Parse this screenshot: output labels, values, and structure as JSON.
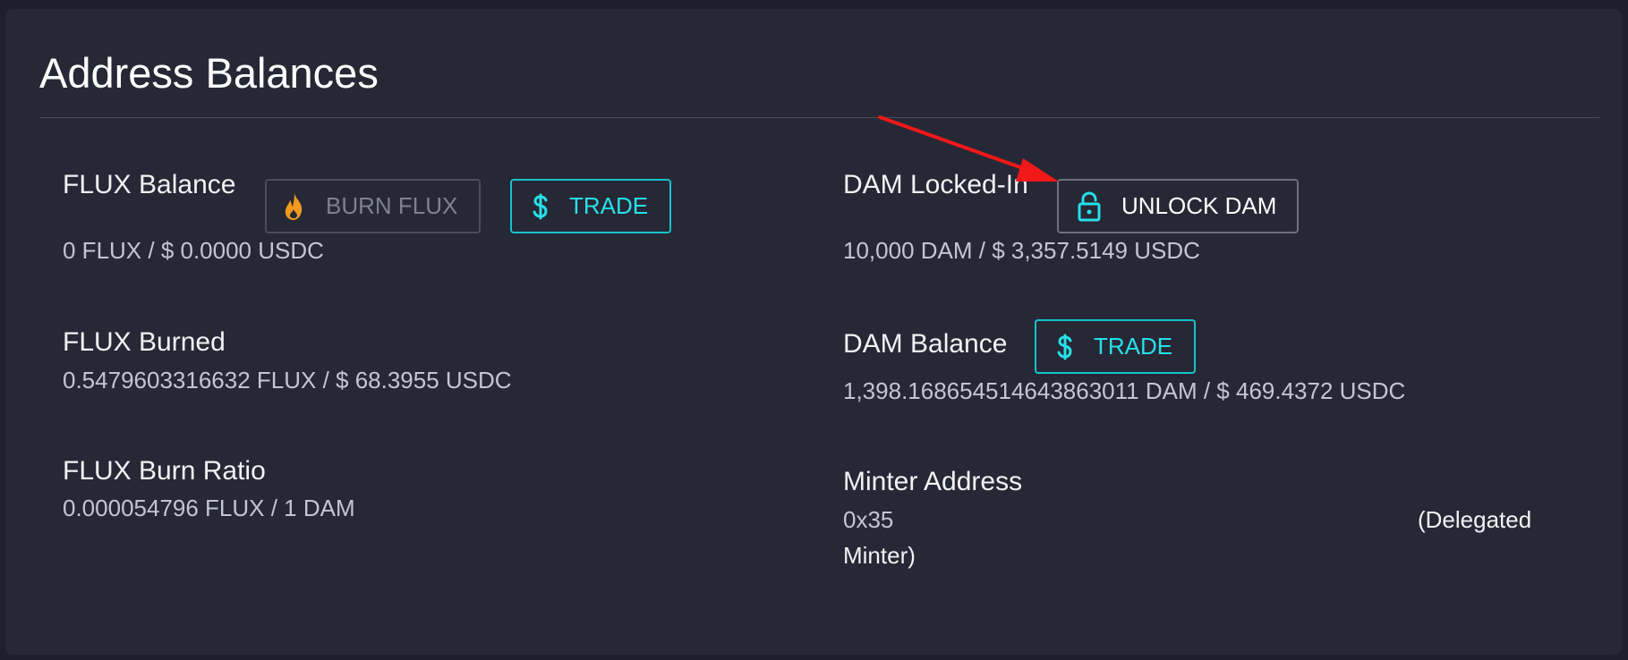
{
  "header": {
    "title": "Address Balances"
  },
  "flux_balance": {
    "label": "FLUX Balance",
    "value": "0 FLUX / $ 0.0000 USDC",
    "burn_button": "BURN FLUX",
    "trade_button": "TRADE"
  },
  "flux_burned": {
    "label": "FLUX Burned",
    "value": "0.5479603316632 FLUX / $ 68.3955 USDC"
  },
  "flux_burn_ratio": {
    "label": "FLUX Burn Ratio",
    "value": "0.000054796 FLUX / 1 DAM"
  },
  "dam_locked": {
    "label": "DAM Locked-In",
    "value": "10,000 DAM / $ 3,357.5149 USDC",
    "unlock_button": "UNLOCK DAM"
  },
  "dam_balance": {
    "label": "DAM Balance",
    "value": "1,398.168654514643863011 DAM / $ 469.4372 USDC",
    "trade_button": "TRADE"
  },
  "minter": {
    "label": "Minter Address",
    "address": "0x35",
    "note_part1": "(Delegated",
    "note_part2": "Minter)"
  },
  "icons": {
    "burn": "fire-icon",
    "trade": "dollar-icon",
    "unlock": "lock-open-icon",
    "annotation": "red-arrow"
  },
  "colors": {
    "background": "#1d1f2a",
    "card": "#262835",
    "accent_teal": "#25e1e9",
    "fire_orange": "#f39a1e",
    "arrow_red": "#f01818"
  }
}
